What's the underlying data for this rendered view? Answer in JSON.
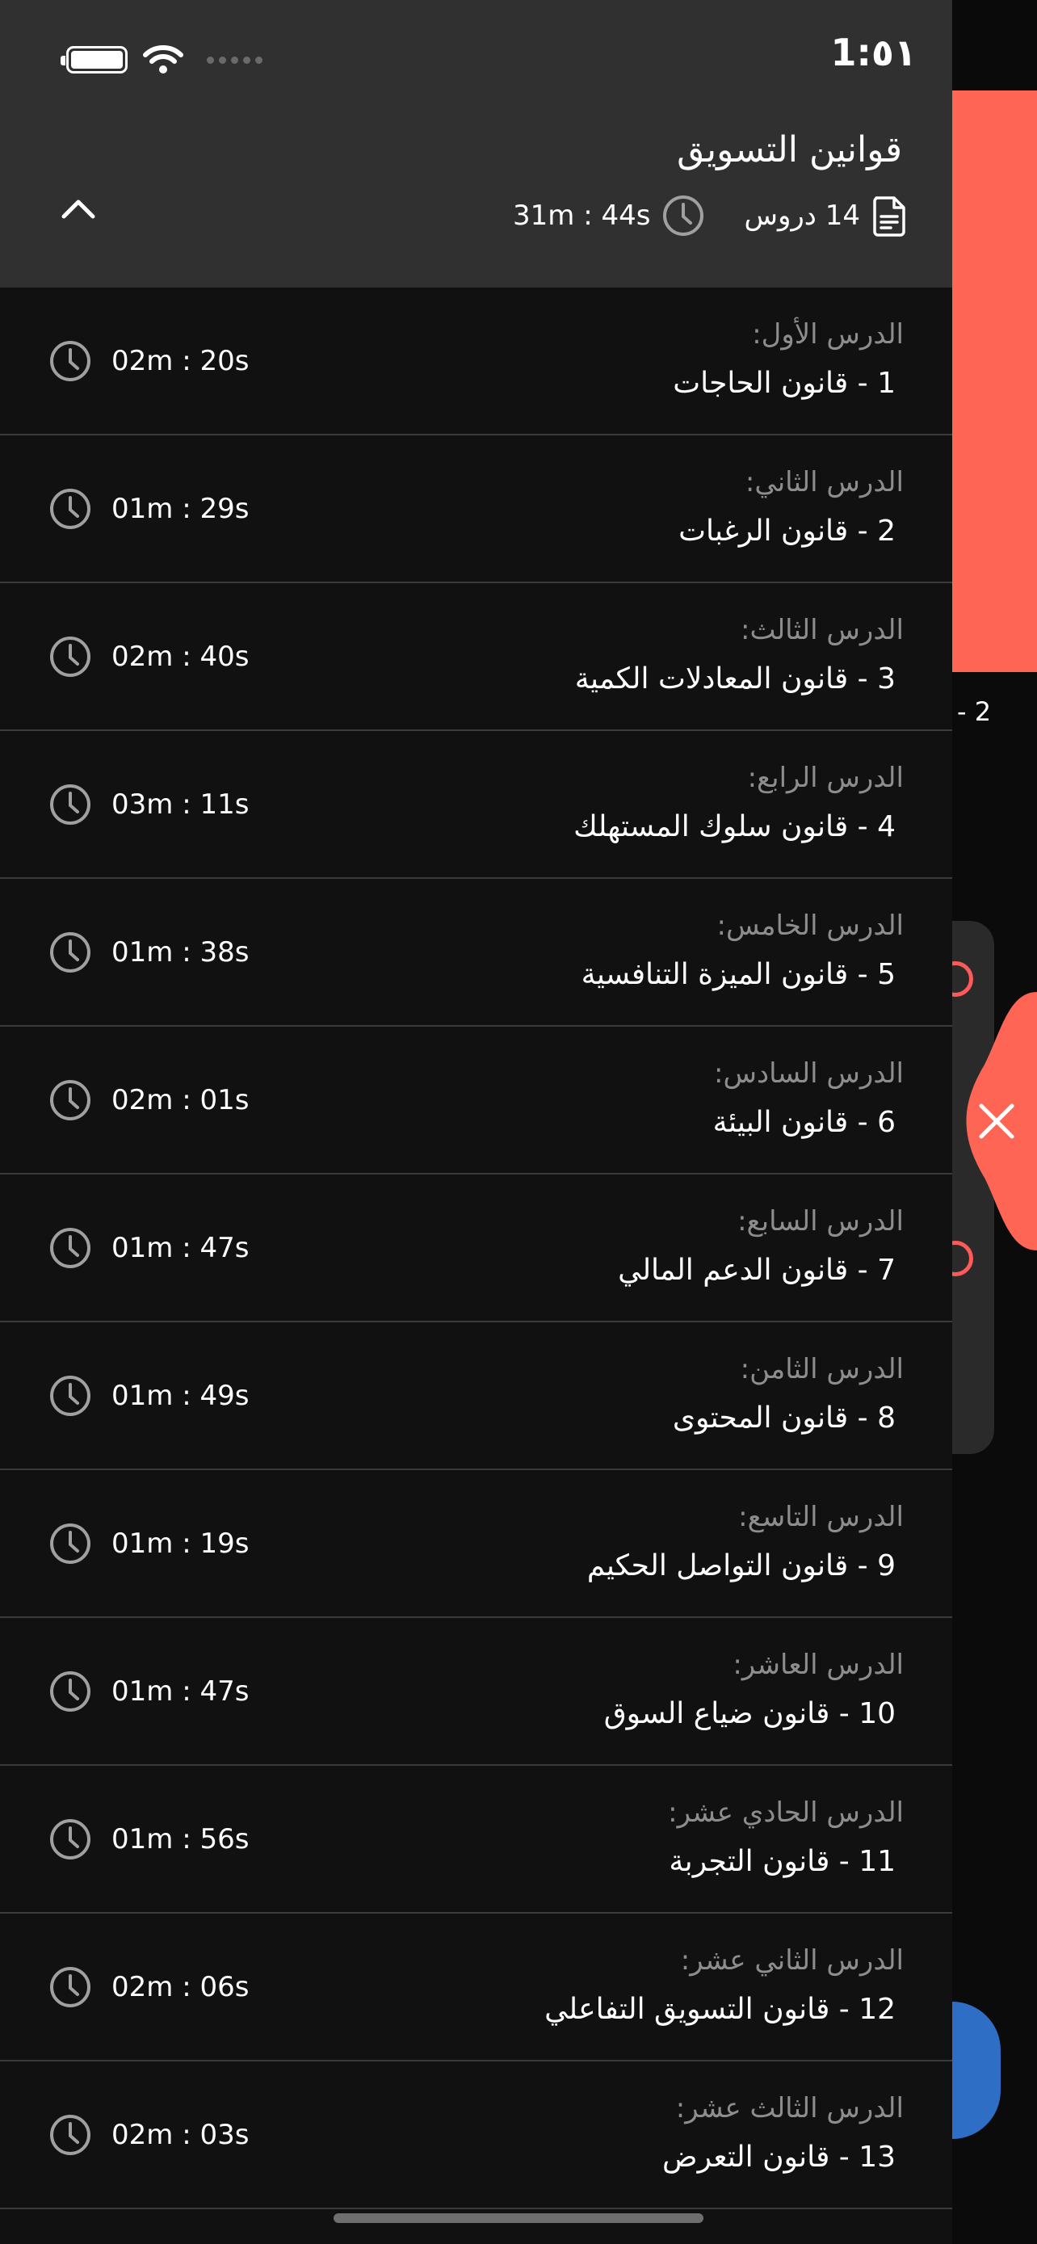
{
  "status_bar": {
    "time": "1:٥١"
  },
  "course": {
    "title": "قوانين التسويق",
    "lessons_count": "14 دروس",
    "total_duration": "31m : 44s"
  },
  "lessons": [
    {
      "label": "الدرس الأول:",
      "title": "1 - قانون الحاجات",
      "duration": "02m : 20s"
    },
    {
      "label": "الدرس الثاني:",
      "title": "2 - قانون الرغبات",
      "duration": "01m : 29s"
    },
    {
      "label": "الدرس الثالث:",
      "title": "3 - قانون المعادلات الكمية",
      "duration": "02m : 40s"
    },
    {
      "label": "الدرس الرابع:",
      "title": "4 - قانون سلوك المستهلك",
      "duration": "03m : 11s"
    },
    {
      "label": "الدرس الخامس:",
      "title": "5 - قانون الميزة التنافسية",
      "duration": "01m : 38s"
    },
    {
      "label": "الدرس السادس:",
      "title": "6 - قانون البيئة",
      "duration": "02m : 01s"
    },
    {
      "label": "الدرس السابع:",
      "title": "7 - قانون الدعم المالي",
      "duration": "01m : 47s"
    },
    {
      "label": "الدرس الثامن:",
      "title": "8 - قانون المحتوى",
      "duration": "01m : 49s"
    },
    {
      "label": "الدرس التاسع:",
      "title": "9 - قانون التواصل الحكيم",
      "duration": "01m : 19s"
    },
    {
      "label": "الدرس العاشر:",
      "title": "10 - قانون ضياع السوق",
      "duration": "01m : 47s"
    },
    {
      "label": "الدرس الحادي عشر:",
      "title": "11 - قانون التجربة",
      "duration": "01m : 56s"
    },
    {
      "label": "الدرس الثاني عشر:",
      "title": "12 - قانون التسويق التفاعلي",
      "duration": "02m : 06s"
    },
    {
      "label": "الدرس الثالث عشر:",
      "title": "13 - قانون التعرض",
      "duration": "02m : 03s"
    }
  ],
  "background_page": {
    "partial_text": "- 2"
  },
  "colors": {
    "header_bg": "#303030",
    "list_bg": "#111111",
    "accent_red": "#ff6554",
    "accent_blue": "#2f6ec5",
    "label_gray": "#8d8d8d"
  },
  "icons": {
    "collapse": "chevron-up-icon",
    "lessons": "document-icon",
    "duration": "clock-icon",
    "close": "close-icon"
  }
}
